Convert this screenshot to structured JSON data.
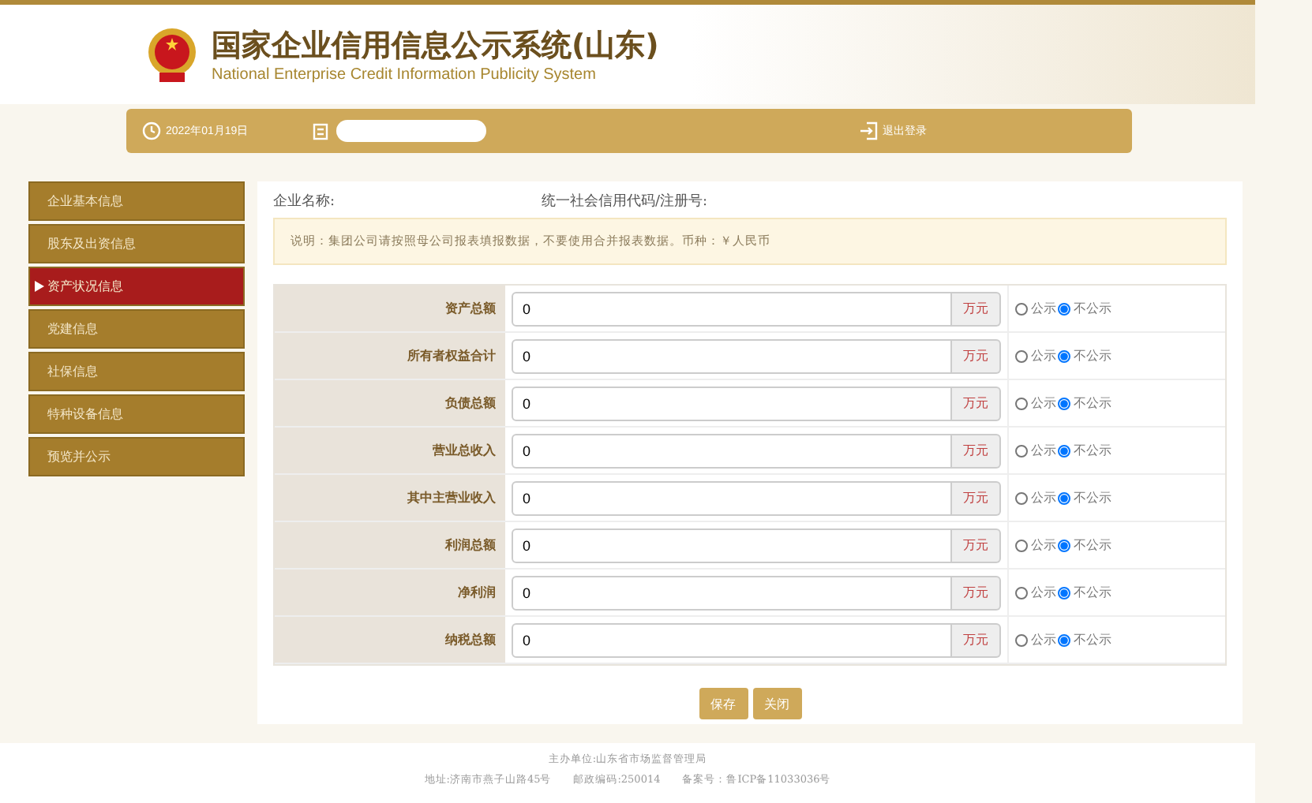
{
  "header": {
    "title": "国家企业信用信息公示系统(山东)",
    "subtitle": "National Enterprise Credit Information Publicity System"
  },
  "userbar": {
    "date": "2022年01月19日",
    "logout": "退出登录"
  },
  "sidebar": {
    "items": [
      {
        "label": "企业基本信息",
        "selected": false
      },
      {
        "label": "股东及出资信息",
        "selected": false
      },
      {
        "label": "资产状况信息",
        "selected": true
      },
      {
        "label": "党建信息",
        "selected": false
      },
      {
        "label": "社保信息",
        "selected": false
      },
      {
        "label": "特种设备信息",
        "selected": false
      },
      {
        "label": "预览并公示",
        "selected": false
      }
    ]
  },
  "company": {
    "name_label": "企业名称:",
    "code_label": "统一社会信用代码/注册号:"
  },
  "notice": "说明：集团公司请按照母公司报表填报数据，不要使用合并报表数据。币种：￥人民币",
  "form": {
    "rows": [
      {
        "label": "资产总额",
        "value": "0",
        "unit": "万元",
        "publish_label": "公示",
        "hide_label": "不公示",
        "publish": false
      },
      {
        "label": "所有者权益合计",
        "value": "0",
        "unit": "万元",
        "publish_label": "公示",
        "hide_label": "不公示",
        "publish": false
      },
      {
        "label": "负债总额",
        "value": "0",
        "unit": "万元",
        "publish_label": "公示",
        "hide_label": "不公示",
        "publish": false
      },
      {
        "label": "营业总收入",
        "value": "0",
        "unit": "万元",
        "publish_label": "公示",
        "hide_label": "不公示",
        "publish": false
      },
      {
        "label": "其中主营业收入",
        "value": "0",
        "unit": "万元",
        "publish_label": "公示",
        "hide_label": "不公示",
        "publish": false
      },
      {
        "label": "利润总额",
        "value": "0",
        "unit": "万元",
        "publish_label": "公示",
        "hide_label": "不公示",
        "publish": false
      },
      {
        "label": "净利润",
        "value": "0",
        "unit": "万元",
        "publish_label": "公示",
        "hide_label": "不公示",
        "publish": false
      },
      {
        "label": "纳税总额",
        "value": "0",
        "unit": "万元",
        "publish_label": "公示",
        "hide_label": "不公示",
        "publish": false
      }
    ]
  },
  "buttons": [
    "保存",
    "关闭"
  ],
  "footer": {
    "sponsor": "主办单位:山东省市场监督管理局",
    "address": "地址:济南市燕子山路45号",
    "postcode": "邮政编码:250014",
    "icp": "备案号：鲁ICP备11033036号"
  }
}
